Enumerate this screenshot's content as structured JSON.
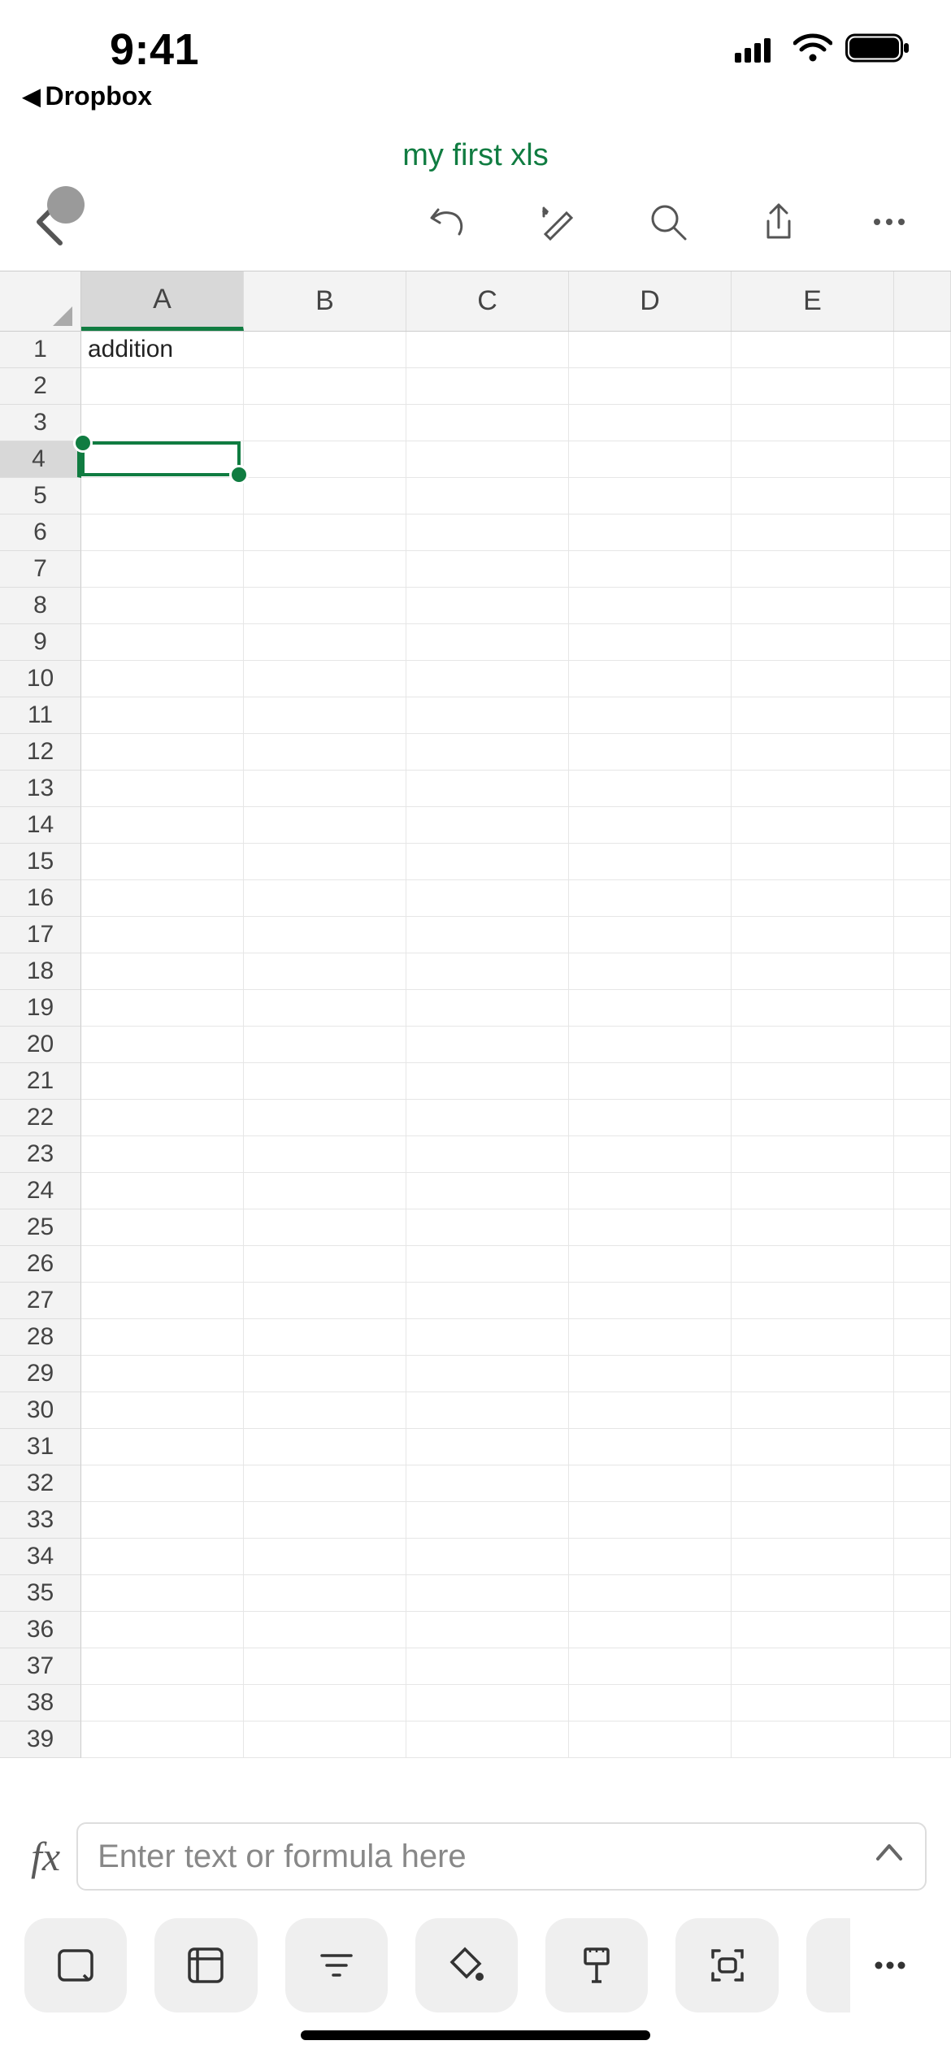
{
  "status_bar": {
    "time": "9:41"
  },
  "back_app": {
    "label": "Dropbox"
  },
  "document": {
    "title": "my first xls"
  },
  "columns": [
    "A",
    "B",
    "C",
    "D",
    "E"
  ],
  "selected_column_index": 0,
  "selected_row_index": 3,
  "row_count": 39,
  "cells": {
    "A1": "addition"
  },
  "selection": {
    "ref": "A4"
  },
  "formula_bar": {
    "prefix": "fx",
    "placeholder": "Enter text or formula here"
  }
}
